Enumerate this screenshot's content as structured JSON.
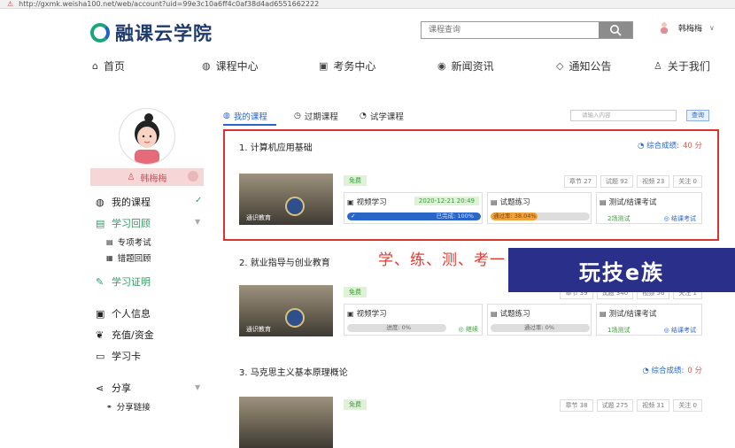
{
  "browser": {
    "url": "http://gxmk.weisha100.net/web/account?uid=99e3c10a6ff4c0af38d4ad6551662222"
  },
  "logo": {
    "text": "融课云学院"
  },
  "search": {
    "placeholder": "课程查询"
  },
  "user": {
    "name": "韩梅梅"
  },
  "nav": [
    {
      "label": "首页",
      "icon": "home-icon"
    },
    {
      "label": "课程中心",
      "icon": "book-icon"
    },
    {
      "label": "考务中心",
      "icon": "exam-icon"
    },
    {
      "label": "新闻资讯",
      "icon": "news-icon"
    },
    {
      "label": "通知公告",
      "icon": "notice-icon"
    },
    {
      "label": "关于我们",
      "icon": "about-icon"
    }
  ],
  "sidebar": {
    "name": "韩梅梅",
    "items": [
      {
        "label": "我的课程"
      },
      {
        "label": "学习回顾"
      },
      {
        "label": "专项考试"
      },
      {
        "label": "错题回顾"
      },
      {
        "label": "学习证明"
      },
      {
        "label": "个人信息"
      },
      {
        "label": "充值/资金"
      },
      {
        "label": "学习卡"
      },
      {
        "label": "分享"
      },
      {
        "label": "分享链接"
      }
    ]
  },
  "tabs": [
    {
      "label": "我的课程"
    },
    {
      "label": "过期课程"
    },
    {
      "label": "试学课程"
    }
  ],
  "tab_search": {
    "placeholder": "请输入内容",
    "button": "查询"
  },
  "courses": [
    {
      "title": "1. 计算机应用基础",
      "score_label": "综合成绩:",
      "score": "40 分",
      "free": "免费",
      "chapters": "章节 27",
      "questions": "试题 92",
      "videos": "视频 23",
      "follows": "关注 0",
      "video_label": "视频学习",
      "video_date": "2020-12-21 20:49",
      "video_progress_text": "已完成: 100%",
      "video_progress": 1.0,
      "exercise_label": "试题练习",
      "exercise_progress_text": "通过率: 38.04%",
      "exercise_progress": 0.3804,
      "test_label": "测试/结课考试",
      "test_count": "2场测试",
      "test_link": "结课考试",
      "thumb_caption": "通识教育"
    },
    {
      "title": "2. 就业指导与创业教育",
      "free": "免费",
      "chapters": "章节 39",
      "questions": "试题 340",
      "videos": "视频 56",
      "follows": "关注 1",
      "video_label": "视频学习",
      "video_progress_text": "进度: 0%",
      "video_progress": 0,
      "continue": "继续",
      "exercise_label": "试题练习",
      "exercise_progress_text": "通过率: 0%",
      "exercise_progress": 0,
      "test_label": "测试/结课考试",
      "test_count": "1场测试",
      "test_link": "结课考试",
      "thumb_caption": "通识教育"
    },
    {
      "title": "3. 马克思主义基本原理概论",
      "score_label": "综合成绩:",
      "score": "0 分",
      "free": "免费",
      "chapters": "章节 38",
      "questions": "试题 275",
      "videos": "视频 31",
      "follows": "关注 0"
    }
  ],
  "annotation": "学、练、测、考一",
  "watermark": "玩技e族",
  "colors": {
    "accent": "#2a66c8",
    "green": "#1aa67a",
    "red": "#d8332c",
    "orange": "#f0a23c"
  }
}
